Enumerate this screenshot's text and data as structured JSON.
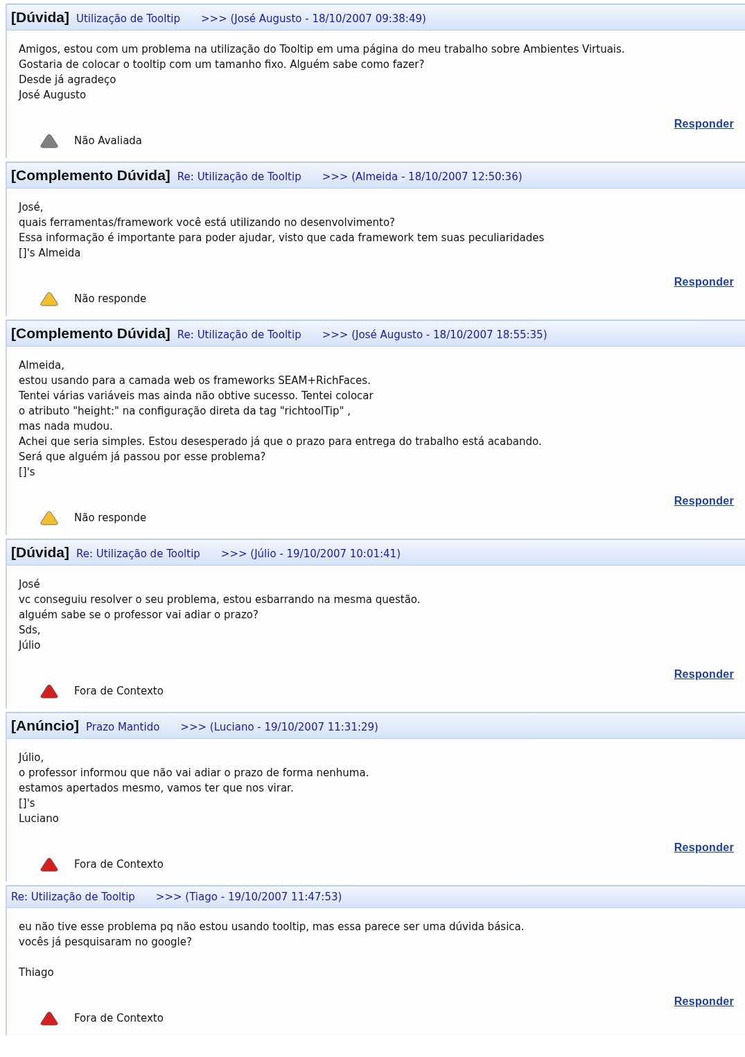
{
  "posts": [
    {
      "type": "[Dúvida]",
      "subject": "Utilização de Tooltip",
      "meta": ">>> (José Augusto - 18/10/2007 09:38:49)",
      "paragraphs": [
        [
          "Amigos, estou com um problema na utilização do Tooltip em uma página do meu trabalho sobre Ambientes Virtuais.",
          "Gostaria de colocar o tooltip com um tamanho fixo. Alguém sabe como fazer?",
          "Desde já agradeço",
          "José Augusto"
        ]
      ],
      "reply": "Responder",
      "rating": {
        "label": "Não Avaliada",
        "color": "#808080"
      }
    },
    {
      "type": "[Complemento Dúvida]",
      "subject": "Re: Utilização de Tooltip",
      "meta": ">>> (Almeida - 18/10/2007 12:50:36)",
      "paragraphs": [
        [
          "José,",
          "quais ferramentas/framework você está utilizando no desenvolvimento?",
          "Essa informação é importante para poder ajudar, visto que cada framework tem suas peculiaridades",
          "[]'s Almeida"
        ]
      ],
      "reply": "Responder",
      "rating": {
        "label": "Não responde",
        "color": "#f0c030"
      }
    },
    {
      "type": "[Complemento Dúvida]",
      "subject": "Re: Utilização de Tooltip",
      "meta": ">>> (José Augusto - 18/10/2007 18:55:35)",
      "paragraphs": [
        [
          "Almeida,",
          "estou usando para a camada web os frameworks SEAM+RichFaces.",
          "Tentei várias variáveis mas ainda não obtive sucesso. Tentei colocar",
          "o atributo \"height:\" na configuração direta da tag \"richtoolTip\" ,",
          "mas nada mudou.",
          "Achei que seria simples. Estou desesperado já que o prazo para entrega do trabalho está acabando.",
          "Será que alguém já passou por esse problema?",
          "[]'s"
        ]
      ],
      "reply": "Responder",
      "rating": {
        "label": "Não responde",
        "color": "#f0c030"
      }
    },
    {
      "type": "[Dúvida]",
      "subject": "Re: Utilização de Tooltip",
      "meta": ">>> (Júlio - 19/10/2007 10:01:41)",
      "paragraphs": [
        [
          "José",
          "vc conseguiu resolver o seu problema, estou esbarrando na mesma questão.",
          "alguém sabe se o professor vai adiar o prazo?",
          "Sds,",
          "Júlio"
        ]
      ],
      "reply": "Responder",
      "rating": {
        "label": "Fora de Contexto",
        "color": "#d42020"
      }
    },
    {
      "type": "[Anúncio]",
      "subject": "Prazo Mantido",
      "meta": ">>> (Luciano - 19/10/2007 11:31:29)",
      "paragraphs": [
        [
          "Júlio,",
          "o professor informou que não vai adiar o prazo de forma nenhuma.",
          "estamos apertados mesmo, vamos ter que nos virar.",
          "[]'s",
          "Luciano"
        ]
      ],
      "reply": "Responder",
      "rating": {
        "label": "Fora de Contexto",
        "color": "#d42020"
      }
    },
    {
      "subject": "Re: Utilização de Tooltip",
      "meta": ">>> (Tiago - 19/10/2007 11:47:53)",
      "paragraphs": [
        [
          "eu não tive esse problema pq não estou usando tooltip, mas essa parece ser uma dúvida básica.",
          "vocês já pesquisaram no google?"
        ],
        [
          "Thiago"
        ]
      ],
      "reply": "Responder",
      "rating": {
        "label": "Fora de Contexto",
        "color": "#d42020"
      }
    }
  ]
}
